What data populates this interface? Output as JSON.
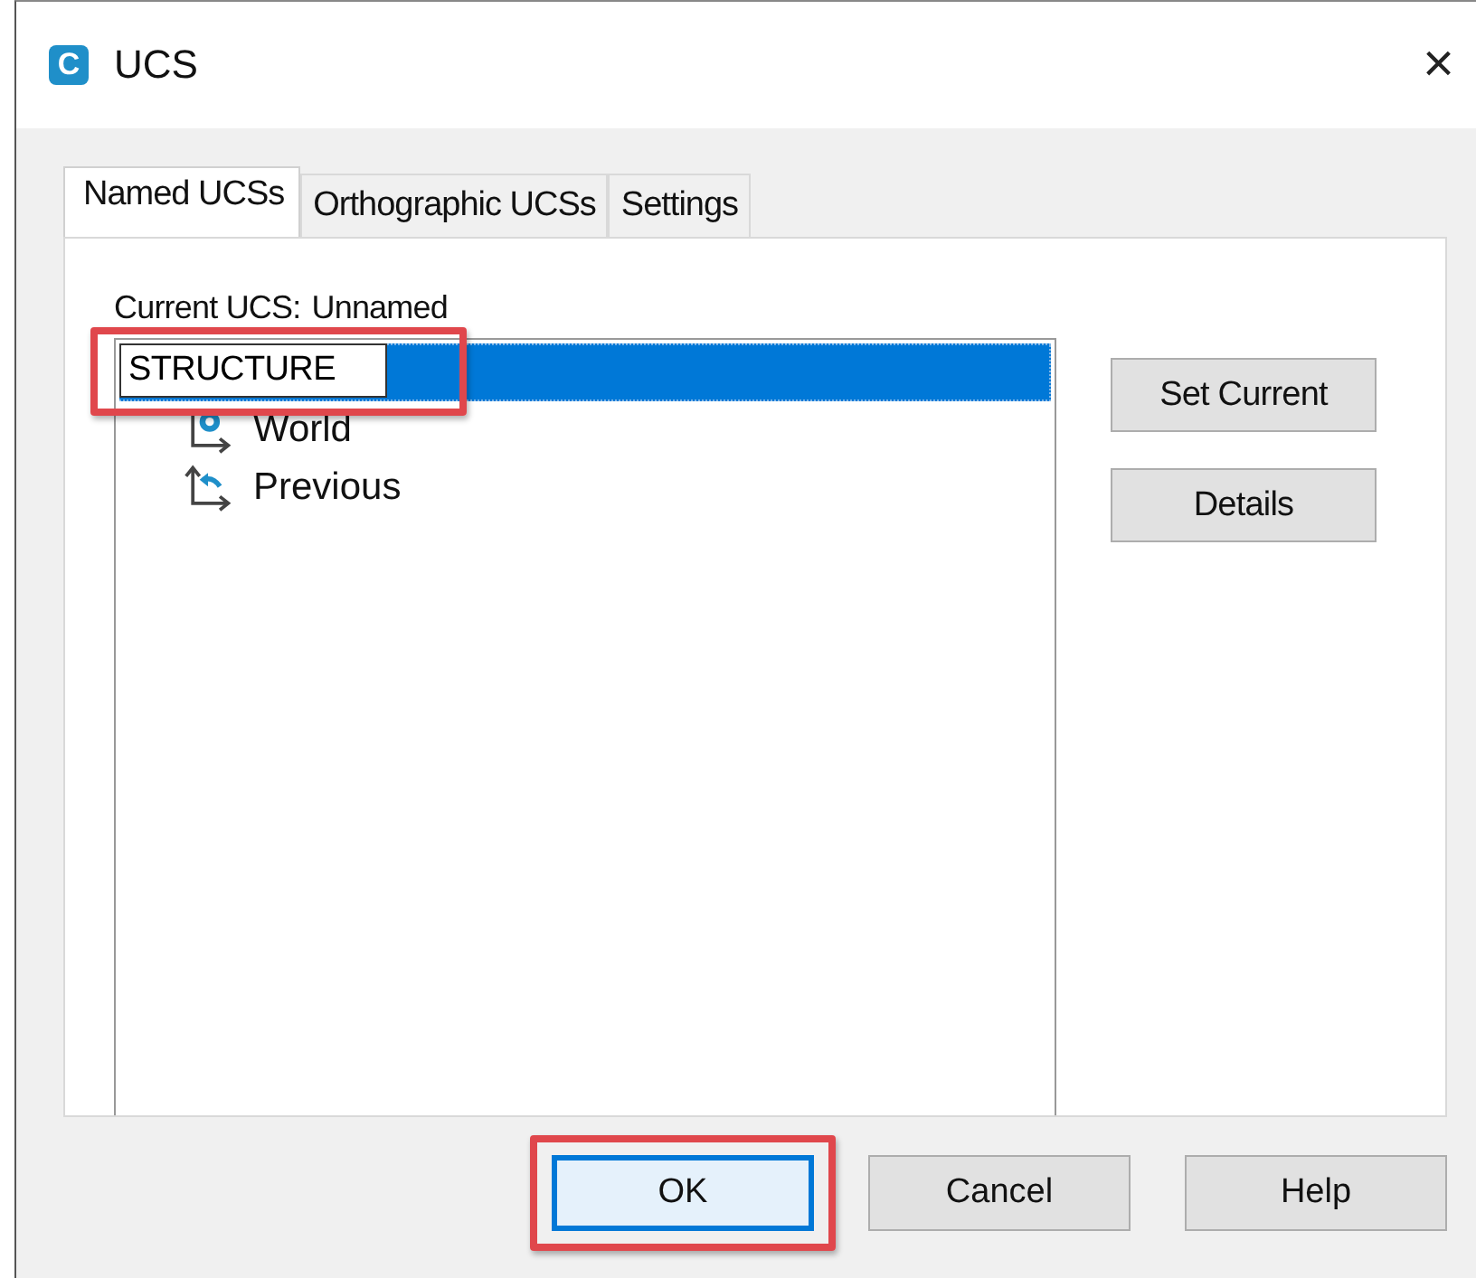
{
  "window": {
    "app_logo": "C",
    "title": "UCS",
    "close": "×"
  },
  "tabs": [
    {
      "label": "Named UCSs",
      "selected": true
    },
    {
      "label": "Orthographic UCSs",
      "selected": false
    },
    {
      "label": "Settings",
      "selected": false
    }
  ],
  "current_ucs": {
    "label": "Current UCS:",
    "value": "Unnamed"
  },
  "ucs_list": [
    {
      "kind": "edit",
      "value": "STRUCTURE",
      "selected": true,
      "highlighted": true
    },
    {
      "kind": "world",
      "label": "World",
      "selected": false
    },
    {
      "kind": "previous",
      "label": "Previous",
      "selected": false
    }
  ],
  "side_buttons": [
    {
      "label": "Set Current"
    },
    {
      "label": "Details"
    }
  ],
  "buttons": [
    {
      "label": "OK",
      "default": true,
      "highlighted": true
    },
    {
      "label": "Cancel",
      "default": false,
      "highlighted": false
    },
    {
      "label": "Help",
      "default": false,
      "highlighted": false
    }
  ]
}
